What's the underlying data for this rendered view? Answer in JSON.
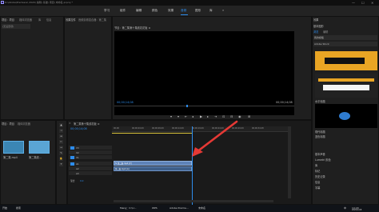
{
  "window": {
    "title": "D:\\Adobe\\Premiere\\ 2020\\ 编辑\\ 基础\\ 项目\\ 未命名.prproj *",
    "min_label": "—",
    "max_label": "☐",
    "close_label": "✕"
  },
  "workspaces": [
    "学习",
    "组件",
    "编辑",
    "颜色",
    "效果",
    "音频",
    "图形",
    "库",
    "»"
  ],
  "project_panel": {
    "tabs": [
      "项目：项目",
      "媒体浏览器",
      "库",
      "信息"
    ],
    "search_placeholder": "(无设置项)"
  },
  "source_panel": {
    "tabs": [
      "效果控件",
      "音频剪辑混合器：第二集",
      "元数据"
    ]
  },
  "program_monitor": {
    "title": "节目：第二集第十集线花花板 ≡",
    "timecode_left": "00;00;14;08",
    "timecode_right": "00;00;14;08"
  },
  "bin_panel": {
    "tabs": [
      "项目：项目",
      "媒体浏览器"
    ],
    "clip1_label": "第二集.mp4",
    "clip2_label": "第二集线..."
  },
  "timeline": {
    "tab_close": "×",
    "sequence_name": "第二集第十集线花板 ≡",
    "timecode": "00;00;14;08",
    "ruler_labels": [
      "00;00",
      "00;00;04;29",
      "00;00;09;29",
      "00;00;14;29",
      "00;00;19;29",
      "00;00;24;29",
      "00;00;29;29",
      "00;00;34;28"
    ],
    "tracks": [
      "V3",
      "V2",
      "V1",
      "A1",
      "A2",
      "A3"
    ],
    "mix_label": "混合",
    "mix_value": "0.0",
    "video_clip_label": "fx 第二集.mp4 [V]",
    "audio_clip_label": "第二集.mp4 [A]"
  },
  "effects_panel": {
    "header": "效果",
    "items": [
      "基本图形",
      "浏览",
      "编辑",
      "我的模板",
      "Adobe Stock"
    ],
    "tile1": "水平标题",
    "tile2": "现代标题",
    "tile3": "蓝色标题",
    "right_list": [
      "基本声音",
      "Lumetri 颜色",
      "库",
      "标记",
      "历史记录",
      "信息",
      "字幕"
    ]
  },
  "taskbar": {
    "items": [
      "开始",
      "搜索",
      "Meng：C:\\U...",
      "WPS",
      "Adobe Premie...",
      "未命名"
    ],
    "clock": "14:29",
    "date": "2020/12/8",
    "lang": "中"
  },
  "colors": {
    "accent": "#2d8ceb",
    "arrow": "#e53935",
    "video_clip": "#5e83b8",
    "audio_clip": "#3e5f8a"
  }
}
